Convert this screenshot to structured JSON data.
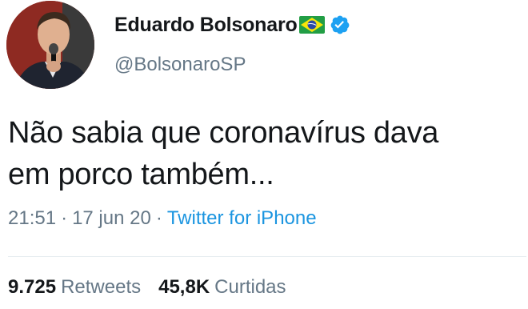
{
  "author": {
    "display_name": "Eduardo Bolsonaro",
    "handle": "@BolsonaroSP",
    "avatar_icon": "profile-photo",
    "flag_icon": "brazil-flag-emoji",
    "verified_icon": "verified-badge-icon",
    "verified_color": "#1da1f2"
  },
  "tweet": {
    "text_line1": "Não sabia que coronavírus dava",
    "text_line2": "em porco também..."
  },
  "meta": {
    "time": "21:51",
    "separator": "·",
    "date": "17 jun 20",
    "source": "Twitter for iPhone",
    "source_color": "#1b95e0"
  },
  "stats": {
    "retweets_count": "9.725",
    "retweets_label": "Retweets",
    "likes_count": "45,8K",
    "likes_label": "Curtidas"
  }
}
